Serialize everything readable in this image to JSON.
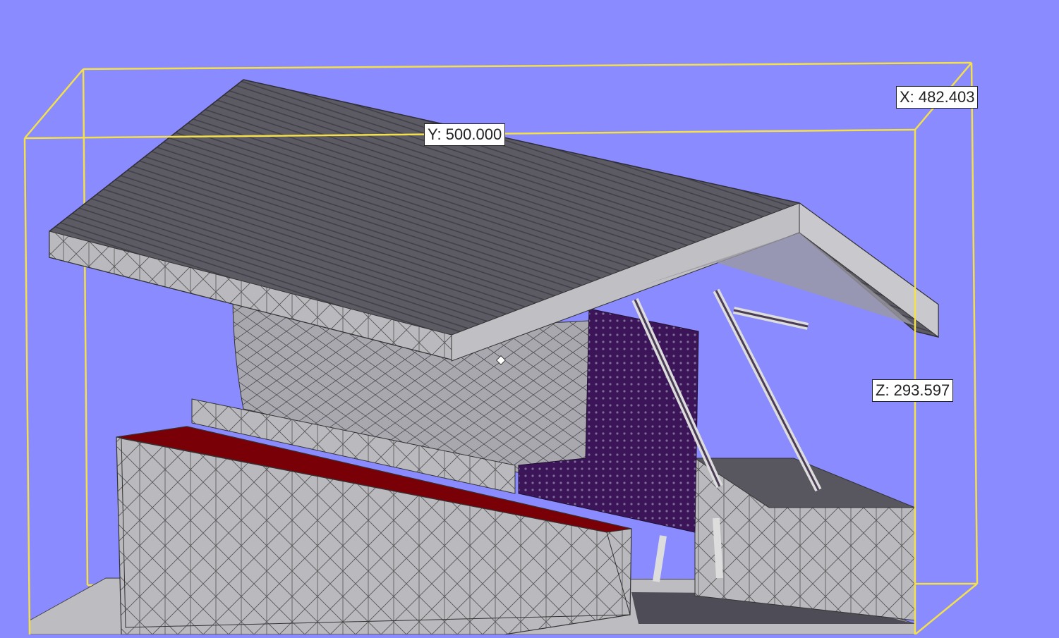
{
  "viewport": {
    "background_color": "#8a8bff",
    "bounding_box_color": "#f3e04a",
    "model_colors": {
      "mesh_face": "#b9b9be",
      "roof_top": "#5c5a63",
      "selected_face": "#7a0008",
      "panel": "#3b1558"
    }
  },
  "dimensions": {
    "x_label": "X: 482.403",
    "y_label": "Y: 500.000",
    "z_label": "Z: 293.597"
  },
  "icons": {
    "cursor": "diamond-cursor-icon"
  }
}
